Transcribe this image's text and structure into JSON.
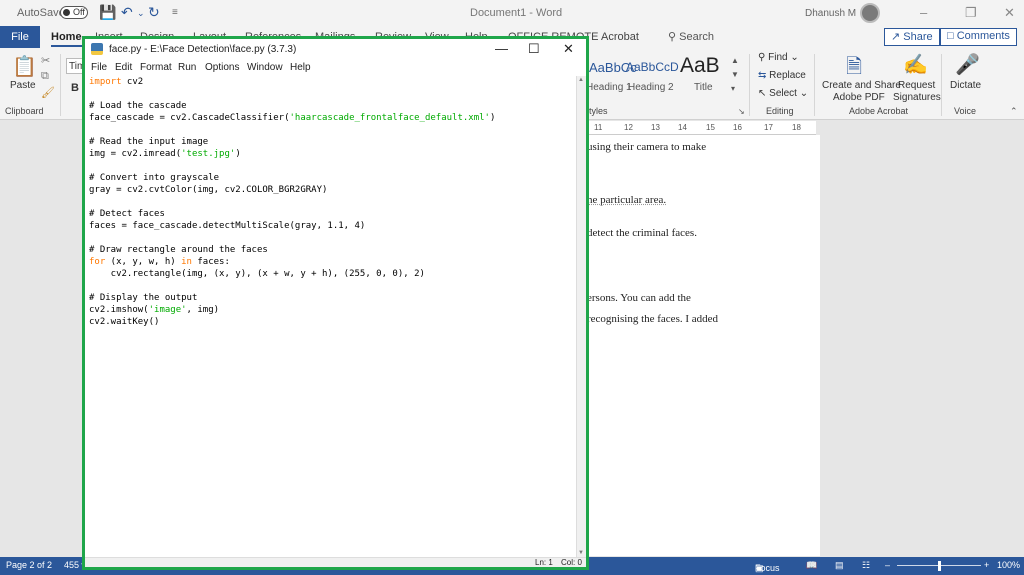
{
  "word": {
    "autosave_label": "AutoSave",
    "autosave_state": "Off",
    "doc_title": "Document1 - Word",
    "user": "Dhanush M",
    "tabs": [
      "File",
      "Home",
      "Insert",
      "Design",
      "Layout",
      "References",
      "Mailings",
      "Review",
      "View",
      "Help",
      "OFFICE REMOTE",
      "Acrobat"
    ],
    "search": "Search",
    "share": "Share",
    "comments": "Comments",
    "font_name": "Tim",
    "paste": "Paste",
    "clipboard": "Clipboard",
    "styles": {
      "items": [
        "AaBbCc",
        "AaBbCcD",
        "AaB"
      ],
      "labels": [
        "Heading 1",
        "Heading 2",
        "Title"
      ],
      "group": "Styles"
    },
    "editing": {
      "find": "Find",
      "replace": "Replace",
      "select": "Select",
      "group": "Editing"
    },
    "acrobat": {
      "create_1": "Create and Share",
      "create_2": "Adobe PDF",
      "request_1": "Request",
      "request_2": "Signatures",
      "group": "Adobe Acrobat"
    },
    "voice": {
      "dictate": "Dictate",
      "group": "Voice"
    },
    "ruler": [
      "11",
      "12",
      "13",
      "14",
      "15",
      "16",
      "17",
      "18"
    ],
    "doc_lines": [
      "using their camera to make",
      "he particular area.",
      "detect the criminal faces.",
      "ersons. You can add the",
      "recognising the faces. I added"
    ],
    "status": {
      "page": "Page 2 of 2",
      "words": "455 w",
      "focus": "Focus",
      "zoom": "100%"
    }
  },
  "idle": {
    "title": "face.py - E:\\Face Detection\\face.py (3.7.3)",
    "menu": [
      "File",
      "Edit",
      "Format",
      "Run",
      "Options",
      "Window",
      "Help"
    ],
    "code": [
      {
        "kw": "import",
        "rest": " cv2"
      },
      {
        "cm": ""
      },
      {
        "cm": "# Load the cascade"
      },
      {
        "pre": "face_cascade = cv2.CascadeClassifier(",
        "st": "'haarcascade_frontalface_default.xml'",
        "post": ")"
      },
      {
        "cm": ""
      },
      {
        "cm": "# Read the input image"
      },
      {
        "pre": "img = cv2.imread(",
        "st": "'test.jpg'",
        "post": ")"
      },
      {
        "cm": ""
      },
      {
        "cm": "# Convert into grayscale"
      },
      {
        "pre": "gray = cv2.cvtColor(img, cv2.COLOR_BGR2GRAY)"
      },
      {
        "cm": ""
      },
      {
        "cm": "# Detect faces"
      },
      {
        "pre": "faces = face_cascade.detectMultiScale(gray, 1.1, 4)"
      },
      {
        "cm": ""
      },
      {
        "cm": "# Draw rectangle around the faces"
      },
      {
        "kw": "for",
        "rest": " (x, y, w, h) ",
        "kw2": "in",
        "rest2": " faces:"
      },
      {
        "pre": "    cv2.rectangle(img, (x, y), (x + w, y + h), (255, 0, 0), 2)"
      },
      {
        "cm": ""
      },
      {
        "cm": "# Display the output"
      },
      {
        "pre": "cv2.imshow(",
        "st": "'image'",
        "post": ", img)"
      },
      {
        "pre": "cv2.waitKey()"
      }
    ],
    "ln": "Ln: 1",
    "col": "Col: 0"
  },
  "colors": {
    "word_blue": "#2b579a",
    "idle_border": "#1fa64a",
    "keyword": "#ff7700",
    "comment": "#dd0000",
    "string": "#00aa00"
  }
}
